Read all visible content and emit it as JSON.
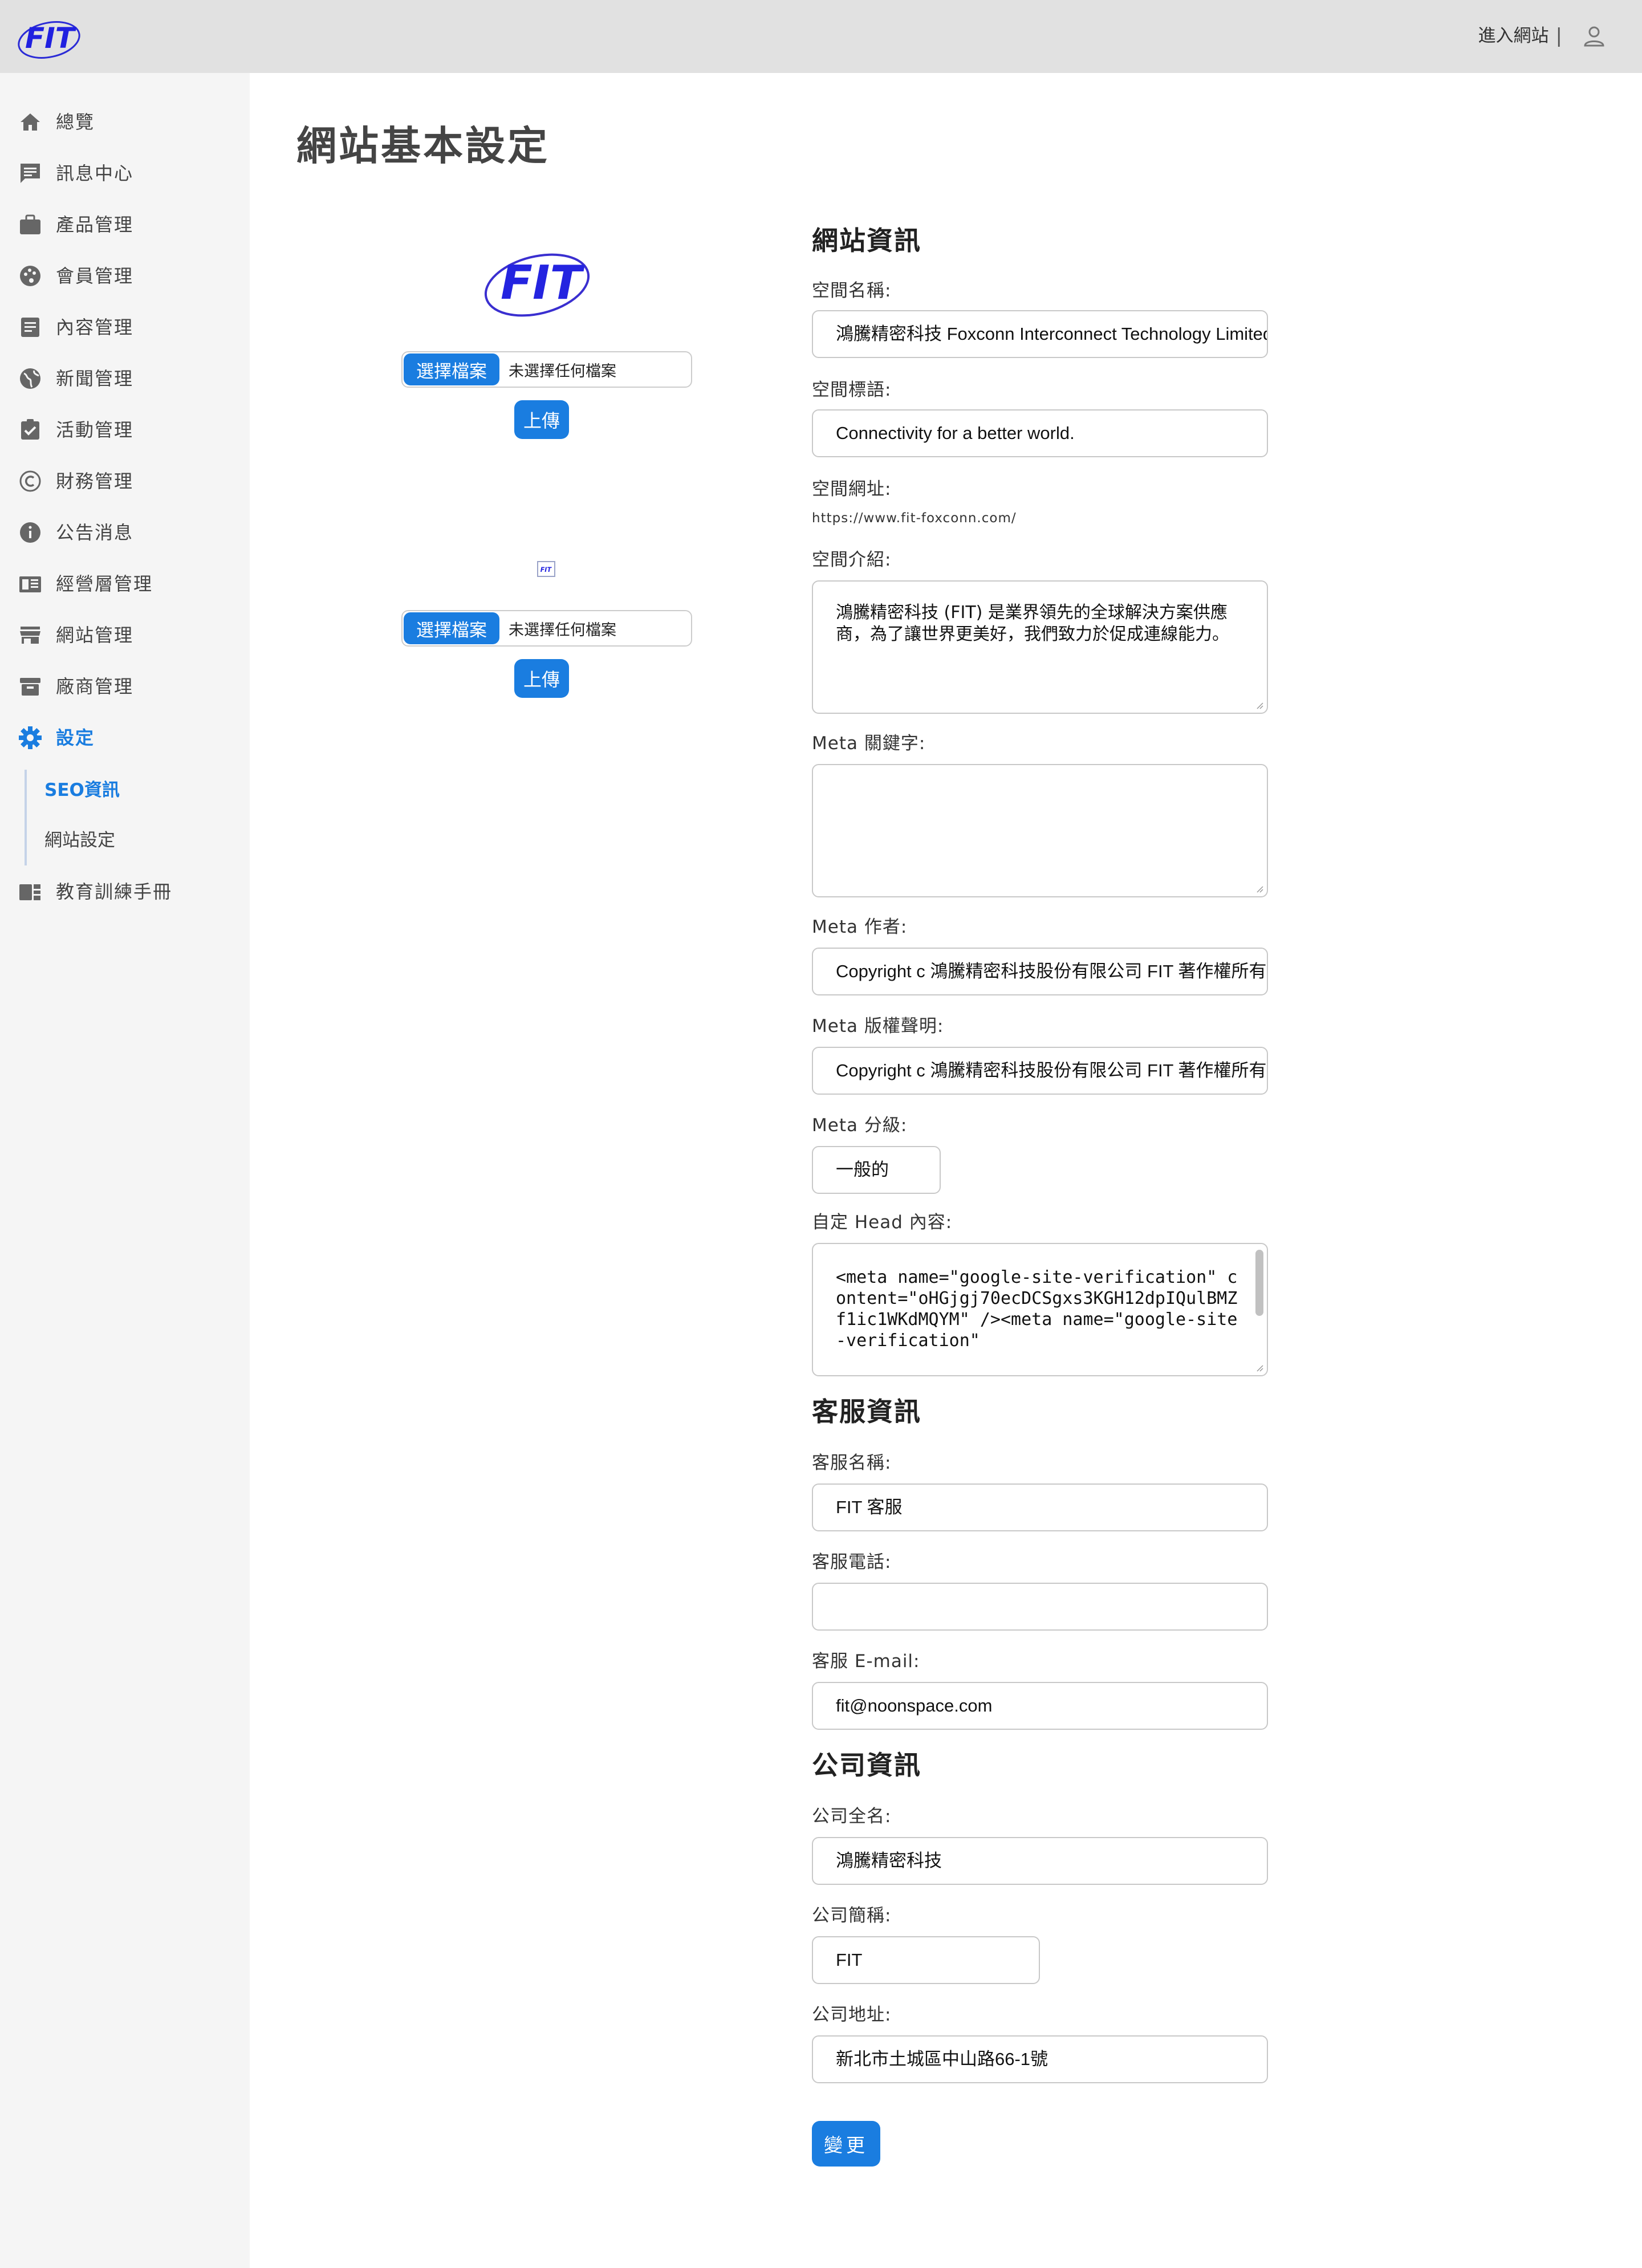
{
  "header": {
    "enter_site": "進入網站",
    "separator": "|"
  },
  "sidebar": {
    "items": [
      {
        "label": "總覽",
        "icon": "home-icon"
      },
      {
        "label": "訊息中心",
        "icon": "message-icon"
      },
      {
        "label": "產品管理",
        "icon": "briefcase-icon"
      },
      {
        "label": "會員管理",
        "icon": "palette-icon"
      },
      {
        "label": "內容管理",
        "icon": "document-icon"
      },
      {
        "label": "新聞管理",
        "icon": "globe-icon"
      },
      {
        "label": "活動管理",
        "icon": "clipboard-check-icon"
      },
      {
        "label": "財務管理",
        "icon": "copyright-icon"
      },
      {
        "label": "公告消息",
        "icon": "info-icon"
      },
      {
        "label": "經營層管理",
        "icon": "book-icon"
      },
      {
        "label": "網站管理",
        "icon": "store-icon"
      },
      {
        "label": "廠商管理",
        "icon": "archive-icon"
      },
      {
        "label": "設定",
        "icon": "gear-icon"
      }
    ],
    "sub_items": [
      {
        "label": "SEO資訊"
      },
      {
        "label": "網站設定"
      }
    ],
    "last_item": {
      "label": "教育訓練手冊",
      "icon": "manual-icon"
    },
    "accent_color": "#1a7de0"
  },
  "page": {
    "title": "網站基本設定"
  },
  "uploads": [
    {
      "choose_label": "選擇檔案",
      "no_file_text": "未選擇任何檔案",
      "upload_label": "上傳"
    },
    {
      "choose_label": "選擇檔案",
      "no_file_text": "未選擇任何檔案",
      "upload_label": "上傳"
    }
  ],
  "site_info": {
    "section_title": "網站資訊",
    "space_name_label": "空間名稱:",
    "space_name_value": "鴻騰精密科技 Foxconn Interconnect Technology Limited",
    "space_slogan_label": "空間標語:",
    "space_slogan_value": "Connectivity for a better world.",
    "space_url_label": "空間網址:",
    "space_url_value": "https://www.fit-foxconn.com/",
    "space_intro_label": "空間介紹:",
    "space_intro_value": "鴻騰精密科技 (FIT) 是業界領先的全球解決方案供應商，為了讓世界更美好，我們致力於促成連線能力。",
    "meta_keywords_label": "Meta 關鍵字:",
    "meta_keywords_value": "",
    "meta_author_label": "Meta 作者:",
    "meta_author_value": "Copyright c 鴻騰精密科技股份有限公司 FIT 著作權所有",
    "meta_copyright_label": "Meta 版權聲明:",
    "meta_copyright_value": "Copyright c 鴻騰精密科技股份有限公司 FIT 著作權所有",
    "meta_rating_label": "Meta 分級:",
    "meta_rating_value": "一般的",
    "custom_head_label": "自定 Head 內容:",
    "custom_head_value": "<meta name=\"google-site-verification\" content=\"oHGjgj70ecDCSgxs3KGH12dpIQulBMZf1ic1WKdMQYM\" /><meta name=\"google-site-verification\""
  },
  "service_info": {
    "section_title": "客服資訊",
    "name_label": "客服名稱:",
    "name_value": "FIT 客服",
    "phone_label": "客服電話:",
    "phone_value": "",
    "email_label": "客服 E-mail:",
    "email_value": "fit@noonspace.com"
  },
  "company_info": {
    "section_title": "公司資訊",
    "full_name_label": "公司全名:",
    "full_name_value": "鴻騰精密科技",
    "short_name_label": "公司簡稱:",
    "short_name_value": "FIT",
    "address_label": "公司地址:",
    "address_value": "新北市土城區中山路66-1號"
  },
  "actions": {
    "submit_label": "變更"
  }
}
